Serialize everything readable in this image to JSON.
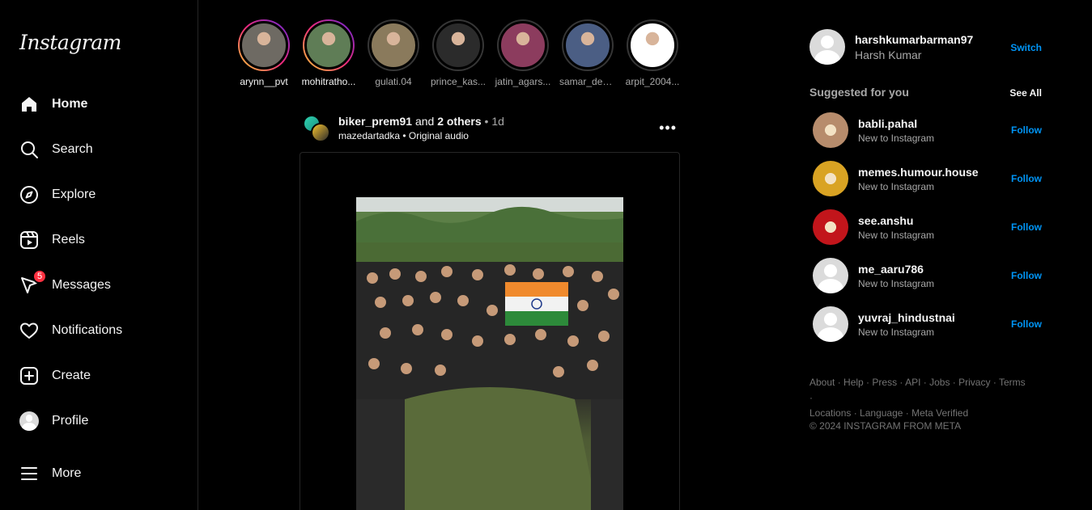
{
  "app": {
    "logo_text": "Instagram"
  },
  "nav": {
    "items": [
      {
        "label": "Home",
        "icon": "home-icon"
      },
      {
        "label": "Search",
        "icon": "search-icon"
      },
      {
        "label": "Explore",
        "icon": "compass-icon"
      },
      {
        "label": "Reels",
        "icon": "reels-icon"
      },
      {
        "label": "Messages",
        "icon": "messenger-icon",
        "badge": "5"
      },
      {
        "label": "Notifications",
        "icon": "heart-icon"
      },
      {
        "label": "Create",
        "icon": "plus-square-icon"
      },
      {
        "label": "Profile",
        "icon": "profile-avatar"
      },
      {
        "label": "More",
        "icon": "hamburger-icon"
      }
    ]
  },
  "stories": [
    {
      "username": "arynn__pvt",
      "seen": false,
      "color": "#6e6a63"
    },
    {
      "username": "mohitratho...",
      "seen": false,
      "color": "#5f7d56"
    },
    {
      "username": "gulati.04",
      "seen": true,
      "color": "#8a7a5c"
    },
    {
      "username": "prince_kas...",
      "seen": true,
      "color": "#2b2b2b"
    },
    {
      "username": "jatin_agars...",
      "seen": true,
      "color": "#8c3c5e"
    },
    {
      "username": "samar_dee...",
      "seen": true,
      "color": "#4b5e84"
    },
    {
      "username": "arpit_2004...",
      "seen": true,
      "color": "#ffffff"
    }
  ],
  "post": {
    "user": "biker_prem91",
    "and_text": " and ",
    "others": "2 others",
    "time": "1d",
    "audio_user": "mazedartadka",
    "audio_label": "Original audio",
    "more_label": "•••"
  },
  "current_user": {
    "username": "harshkumarbarman97",
    "full_name": "Harsh Kumar",
    "switch_label": "Switch"
  },
  "suggestions": {
    "heading": "Suggested for you",
    "see_all": "See All",
    "follow_label": "Follow",
    "items": [
      {
        "username": "babli.pahal",
        "subtitle": "New to Instagram",
        "color": "#b78c6c"
      },
      {
        "username": "memes.humour.house",
        "subtitle": "New to Instagram",
        "color": "#d9a323"
      },
      {
        "username": "see.anshu",
        "subtitle": "New to Instagram",
        "color": "#c2151b"
      },
      {
        "username": "me_aaru786",
        "subtitle": "New to Instagram",
        "color": "#dbdbdb"
      },
      {
        "username": "yuvraj_hindustnai",
        "subtitle": "New to Instagram",
        "color": "#dbdbdb"
      }
    ]
  },
  "footer": {
    "links_row1": [
      "About",
      "Help",
      "Press",
      "API",
      "Jobs",
      "Privacy",
      "Terms"
    ],
    "links_row2": [
      "Locations",
      "Language",
      "Meta Verified"
    ],
    "copyright": "© 2024 INSTAGRAM FROM META"
  }
}
